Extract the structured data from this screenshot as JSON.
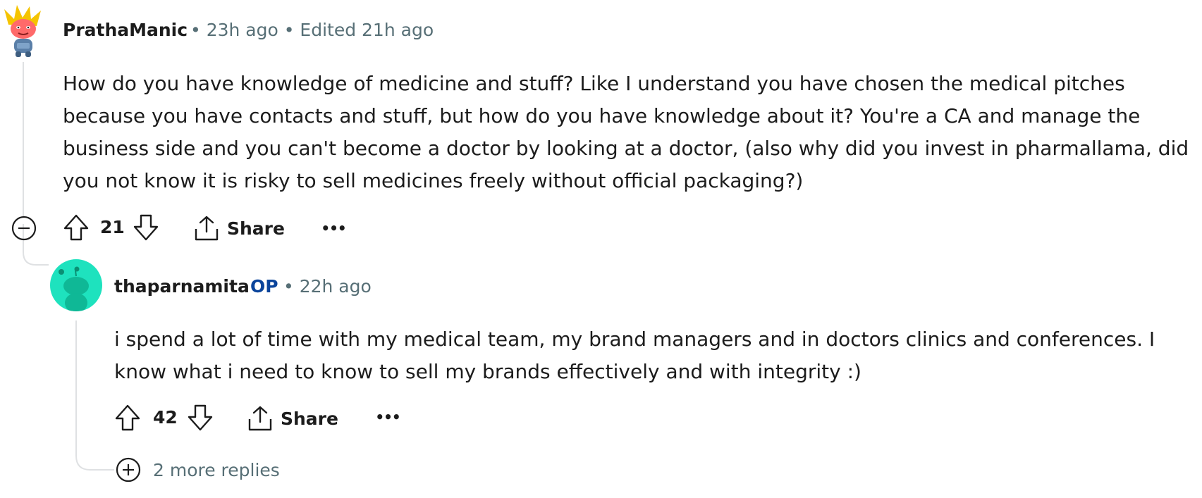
{
  "comments": [
    {
      "username": "PrathaManic",
      "meta": "• 23h ago • Edited 21h ago",
      "body": "How do you have knowledge of medicine and stuff? Like I understand you have chosen the medical pitches because you have contacts and stuff, but how do you have knowledge about it? You're a CA and manage the business side and you can't become a doctor by looking at a doctor, (also why did you invest in pharmallama, did you not know it is risky to sell medicines freely without official packaging?)",
      "votes": "21",
      "share_label": "Share",
      "more_label": "•••",
      "avatar_icon": "mascot-avatar-icon"
    },
    {
      "username": "thaparnamita",
      "op_badge": "OP",
      "meta": "• 22h ago",
      "body": "i spend a lot of time with my medical team, my brand managers and in doctors clinics and conferences. I know what i need to know to sell my brands effectively and with integrity :)",
      "votes": "42",
      "share_label": "Share",
      "more_label": "•••",
      "avatar_icon": "snoo-avatar-icon",
      "avatar_color": "#1ee2be"
    }
  ],
  "more_replies": "2 more replies",
  "colors": {
    "text": "#1c1c1c",
    "meta": "#576f76",
    "op": "#0a449b",
    "thread": "#dfe1e3"
  }
}
